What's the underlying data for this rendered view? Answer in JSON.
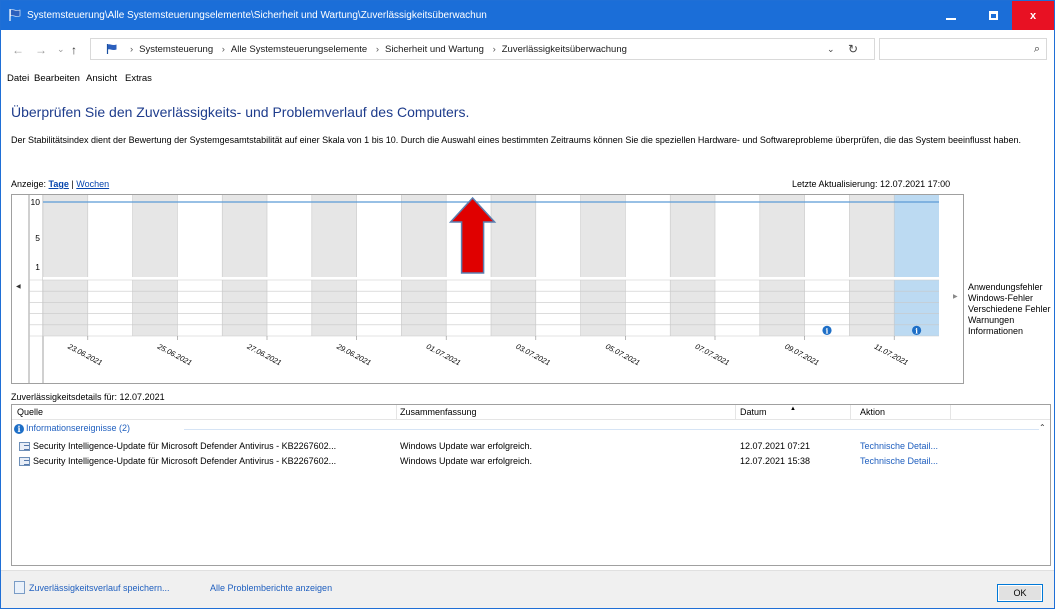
{
  "window": {
    "title": "Systemsteuerung\\Alle Systemsteuerungselemente\\Sicherheit und Wartung\\Zuverlässigkeitsüberwachun",
    "min_label": "",
    "max_label": "",
    "close_label": "x",
    "accent": "#1b6ed8"
  },
  "address": {
    "crumbs": [
      "Systemsteuerung",
      "Alle Systemsteuerungselemente",
      "Sicherheit und Wartung",
      "Zuverlässigkeitsüberwachung"
    ],
    "search_placeholder": ""
  },
  "menu": [
    {
      "label": "Datei"
    },
    {
      "label": "Bearbeiten"
    },
    {
      "label": "Ansicht"
    },
    {
      "label": "Extras"
    }
  ],
  "page": {
    "heading": "Überprüfen Sie den Zuverlässigkeits- und Problemverlauf des Computers.",
    "description": "Der Stabilitätsindex dient der Bewertung der Systemgesamtstabilität auf einer Skala von 1 bis 10. Durch die Auswahl eines bestimmten Zeitraums können Sie die speziellen Hardware- und Softwareprobleme überprüfen, die das System beeinflusst haben.",
    "view_label": "Anzeige:",
    "view_days": "Tage",
    "view_sep": "|",
    "view_weeks": "Wochen",
    "last_update": "Letzte Aktualisierung: 12.07.2021 17:00"
  },
  "chart_data": {
    "type": "line",
    "y_ticks": [
      "10",
      "5",
      "1"
    ],
    "ylim": [
      1,
      10
    ],
    "dates": [
      "23.06.2021",
      "25.06.2021",
      "27.06.2021",
      "29.06.2021",
      "01.07.2021",
      "03.07.2021",
      "05.07.2021",
      "07.07.2021",
      "09.07.2021",
      "11.07.2021"
    ],
    "columns": 20,
    "stability_index": 10,
    "selected_column": 19,
    "legend": [
      "Anwendungsfehler",
      "Windows-Fehler",
      "Verschiedene Fehler",
      "Warnungen",
      "Informationen"
    ],
    "info_markers": [
      {
        "column": 17,
        "row": "Informationen"
      },
      {
        "column": 19,
        "row": "Informationen"
      }
    ],
    "line_color": "#5b9bd5",
    "selected_color": "#bcdaf2",
    "shade_color": "#e6e6e6",
    "annotation_arrow_color": "#e00000"
  },
  "details": {
    "label": "Zuverlässigkeitsdetails für: 12.07.2021",
    "columns": [
      "Quelle",
      "Zusammenfassung",
      "Datum",
      "Aktion"
    ],
    "group": "Informationsereignisse (2)",
    "rows": [
      {
        "source": "Security Intelligence-Update für Microsoft Defender Antivirus - KB2267602...",
        "summary": "Windows Update war erfolgreich.",
        "date": "12.07.2021 07:21",
        "action": "Technische Detail..."
      },
      {
        "source": "Security Intelligence-Update für Microsoft Defender Antivirus - KB2267602...",
        "summary": "Windows Update war erfolgreich.",
        "date": "12.07.2021 15:38",
        "action": "Technische Detail..."
      }
    ]
  },
  "footer": {
    "save_link": "Zuverlässigkeitsverlauf speichern...",
    "reports_link": "Alle Problemberichte anzeigen",
    "ok_label": "OK"
  }
}
